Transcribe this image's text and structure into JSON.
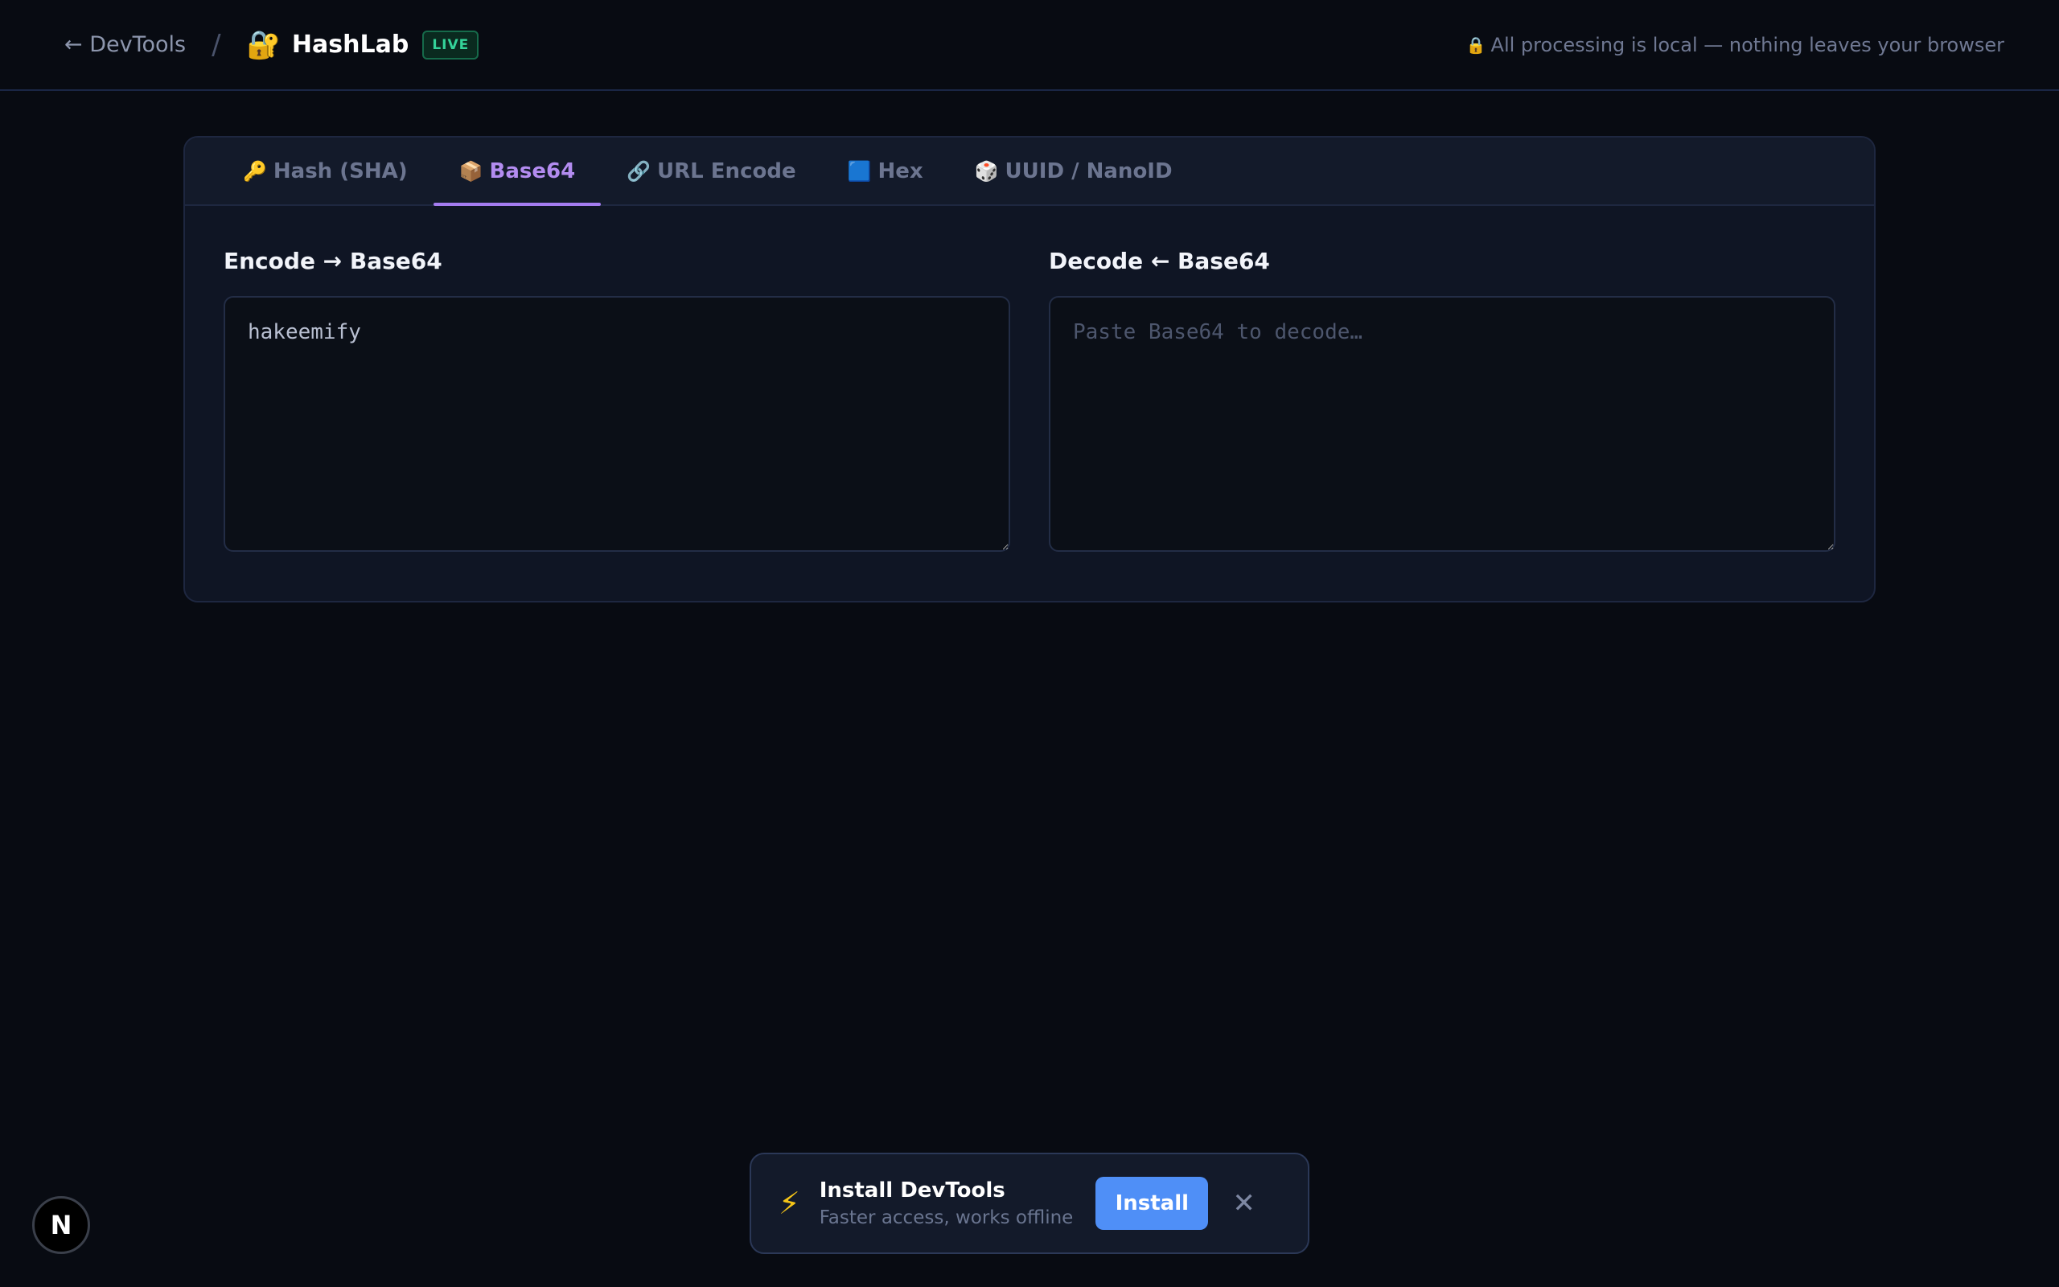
{
  "header": {
    "back_label": "← DevTools",
    "separator": "/",
    "brand_icon": "🔐",
    "brand_name": "HashLab",
    "badge": "LIVE",
    "privacy_icon": "🔒",
    "privacy_text": "All processing is local — nothing leaves your browser"
  },
  "tabs": [
    {
      "icon": "🔑",
      "label": "Hash (SHA)",
      "active": false
    },
    {
      "icon": "📦",
      "label": "Base64",
      "active": true
    },
    {
      "icon": "🔗",
      "label": "URL Encode",
      "active": false
    },
    {
      "icon": "🟦",
      "label": "Hex",
      "active": false
    },
    {
      "icon": "🎲",
      "label": "UUID / NanoID",
      "active": false
    }
  ],
  "encode": {
    "label": "Encode → Base64",
    "value": "hakeemify",
    "placeholder": ""
  },
  "decode": {
    "label": "Decode ← Base64",
    "value": "",
    "placeholder": "Paste Base64 to decode…"
  },
  "toast": {
    "icon": "⚡",
    "title": "Install DevTools",
    "subtitle": "Faster access, works offline",
    "install_label": "Install",
    "close_icon": "✕"
  },
  "float_button": {
    "label": "N"
  },
  "colors": {
    "accent": "#a47cf0",
    "install": "#4f8ff7",
    "live": "#34d399"
  }
}
